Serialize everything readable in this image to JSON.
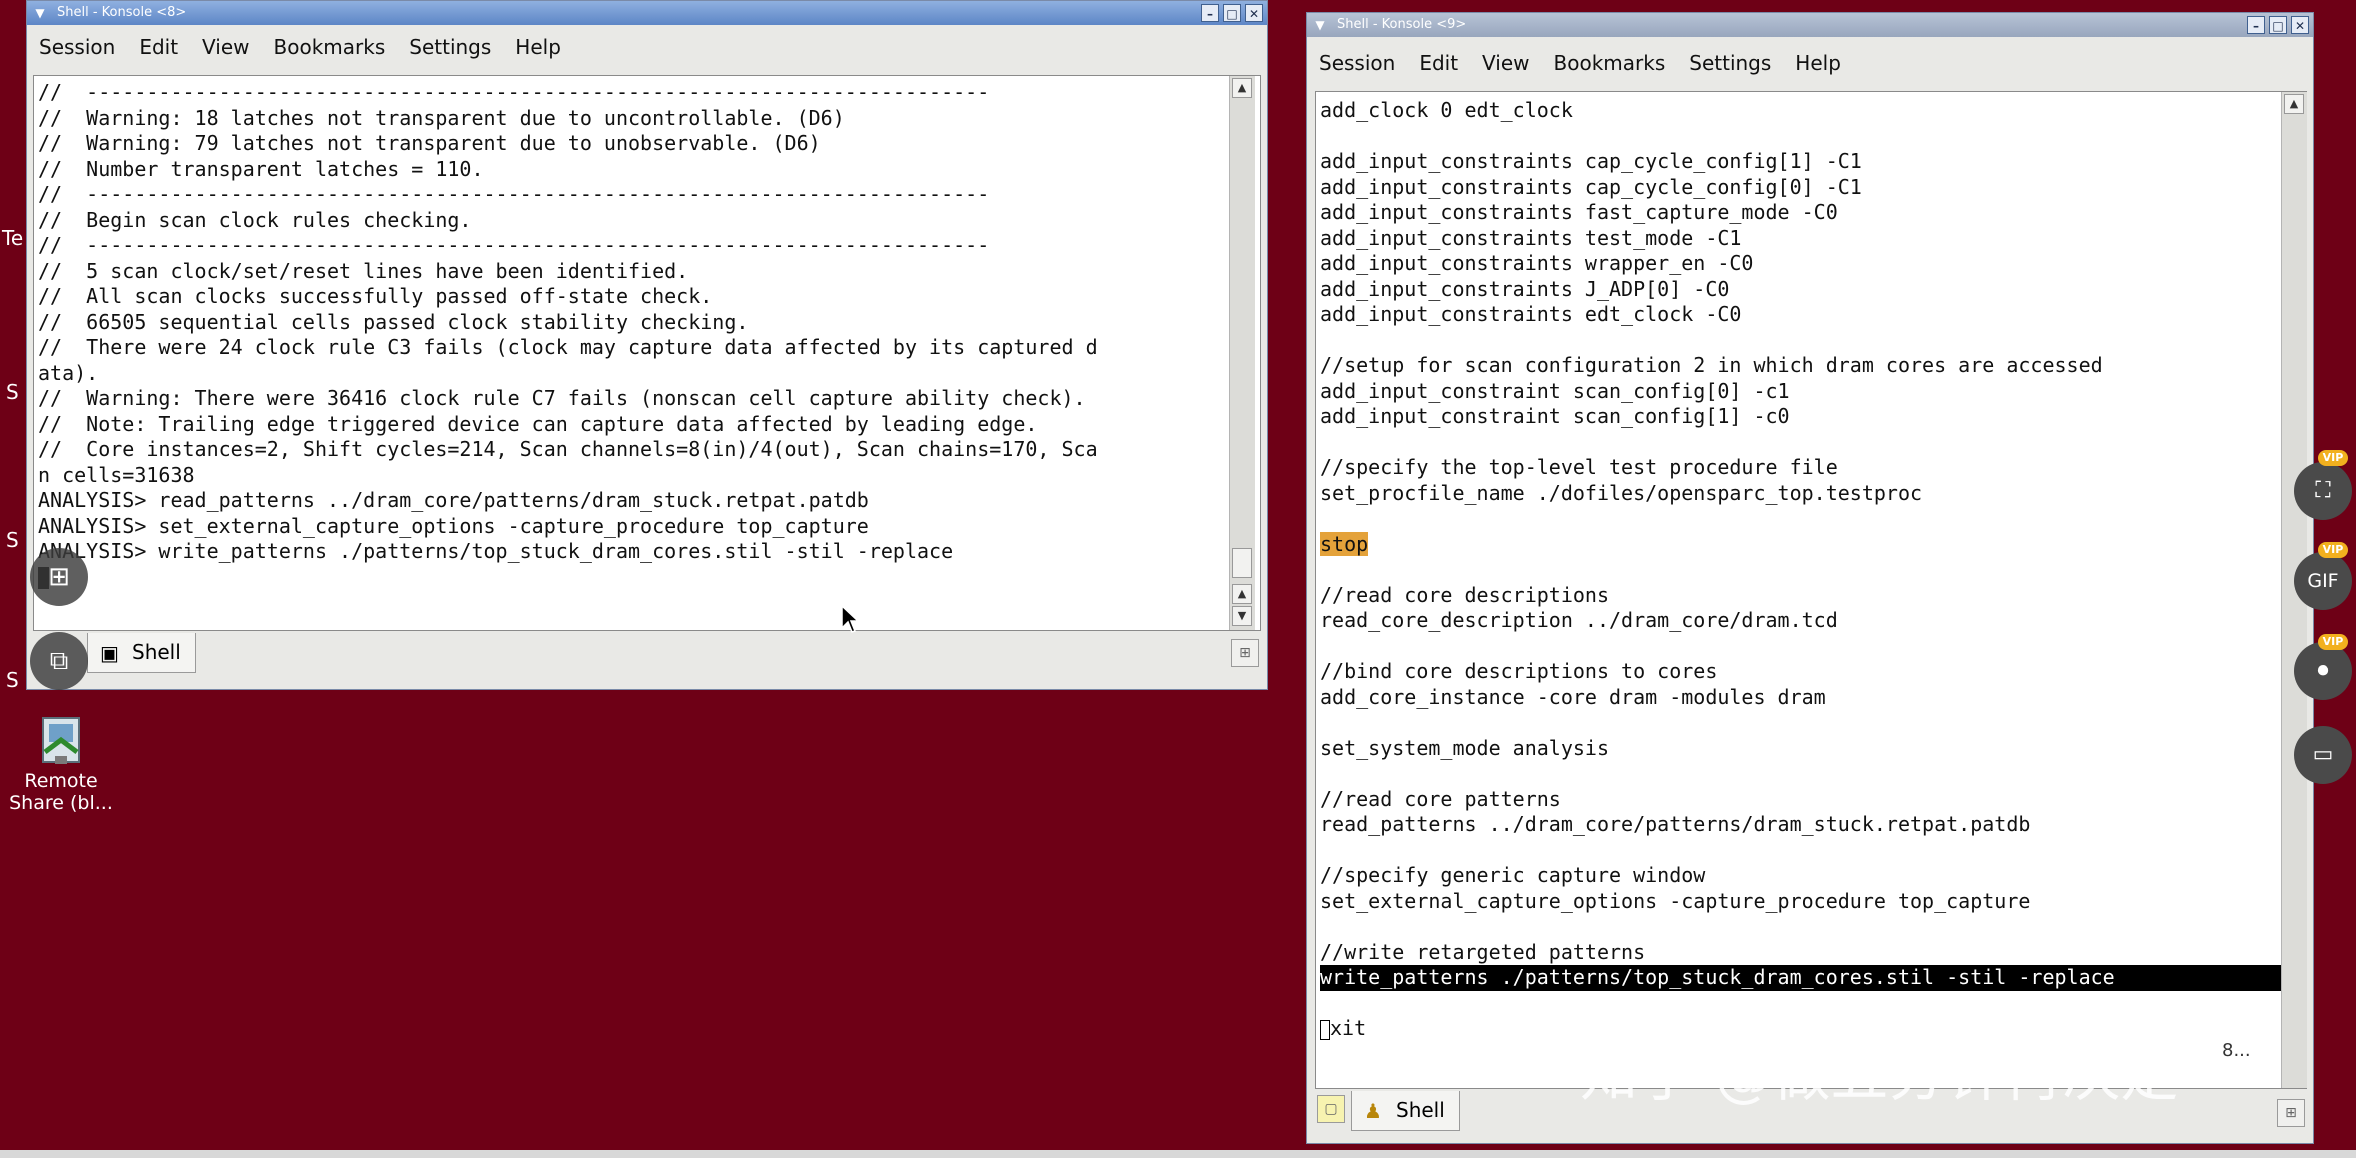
{
  "desktop": {
    "icon_label_line1": "Remote",
    "icon_label_line2": "Share (bl...",
    "edge_labels": [
      "Te",
      "S",
      "S",
      "S",
      "S"
    ]
  },
  "window1": {
    "title": "Shell - Konsole <8>",
    "menu": [
      "Session",
      "Edit",
      "View",
      "Bookmarks",
      "Settings",
      "Help"
    ],
    "lines": [
      "//  ---------------------------------------------------------------------------",
      "//  Warning: 18 latches not transparent due to uncontrollable. (D6)",
      "//  Warning: 79 latches not transparent due to unobservable. (D6)",
      "//  Number transparent latches = 110.",
      "//  ---------------------------------------------------------------------------",
      "//  Begin scan clock rules checking.",
      "//  ---------------------------------------------------------------------------",
      "//  5 scan clock/set/reset lines have been identified.",
      "//  All scan clocks successfully passed off-state check.",
      "//  66505 sequential cells passed clock stability checking.",
      "//  There were 24 clock rule C3 fails (clock may capture data affected by its captured d",
      "ata).",
      "//  Warning: There were 36416 clock rule C7 fails (nonscan cell capture ability check).",
      "//  Note: Trailing edge triggered device can capture data affected by leading edge.",
      "//  Core instances=2, Shift cycles=214, Scan channels=8(in)/4(out), Scan chains=170, Sca",
      "n cells=31638",
      "ANALYSIS> read_patterns ../dram_core/patterns/dram_stuck.retpat.patdb",
      "ANALYSIS> set_external_capture_options -capture_procedure top_capture",
      "ANALYSIS> write_patterns ./patterns/top_stuck_dram_cores.stil -stil -replace"
    ],
    "tab_label": "Shell"
  },
  "window2": {
    "title": "Shell - Konsole <9>",
    "menu": [
      "Session",
      "Edit",
      "View",
      "Bookmarks",
      "Settings",
      "Help"
    ],
    "lines": [
      "add_clock 0 edt_clock",
      "",
      "add_input_constraints cap_cycle_config[1] -C1",
      "add_input_constraints cap_cycle_config[0] -C1",
      "add_input_constraints fast_capture_mode -C0",
      "add_input_constraints test_mode -C1",
      "add_input_constraints wrapper_en -C0",
      "add_input_constraints J_ADP[0] -C0",
      "add_input_constraints edt_clock -C0",
      "",
      "//setup for scan configuration 2 in which dram cores are accessed",
      "add_input_constraint scan_config[0] -c1",
      "add_input_constraint scan_config[1] -c0",
      "",
      "//specify the top-level test procedure file",
      "set_procfile_name ./dofiles/opensparc_top.testproc",
      "",
      "stop",
      "",
      "//read core descriptions",
      "read_core_description ../dram_core/dram.tcd",
      "",
      "//bind core descriptions to cores",
      "add_core_instance -core dram -modules dram",
      "",
      "set_system_mode analysis",
      "",
      "//read core patterns",
      "read_patterns ../dram_core/patterns/dram_stuck.retpat.patdb",
      "",
      "//specify generic capture window",
      "set_external_capture_options -capture_procedure top_capture",
      "",
      "//write retargeted patterns",
      "write_patterns ./patterns/top_stuck_dram_cores.stil -stil -replace",
      "",
      "exit"
    ],
    "highlight_index": 34,
    "stop_index": 17,
    "exit_index": 36,
    "tab_label": "Shell",
    "status_right": "8..."
  },
  "side_tools": [
    "crop-icon",
    "gif-icon",
    "video-icon",
    "screen-record-icon"
  ],
  "vip_badge": "VIP",
  "gif_label": "GIF",
  "watermark": "知乎 @做五分钟再决定",
  "colors": {
    "desktop": "#6e0016",
    "highlight": "#000000",
    "stop_bg": "#e4a23a"
  }
}
